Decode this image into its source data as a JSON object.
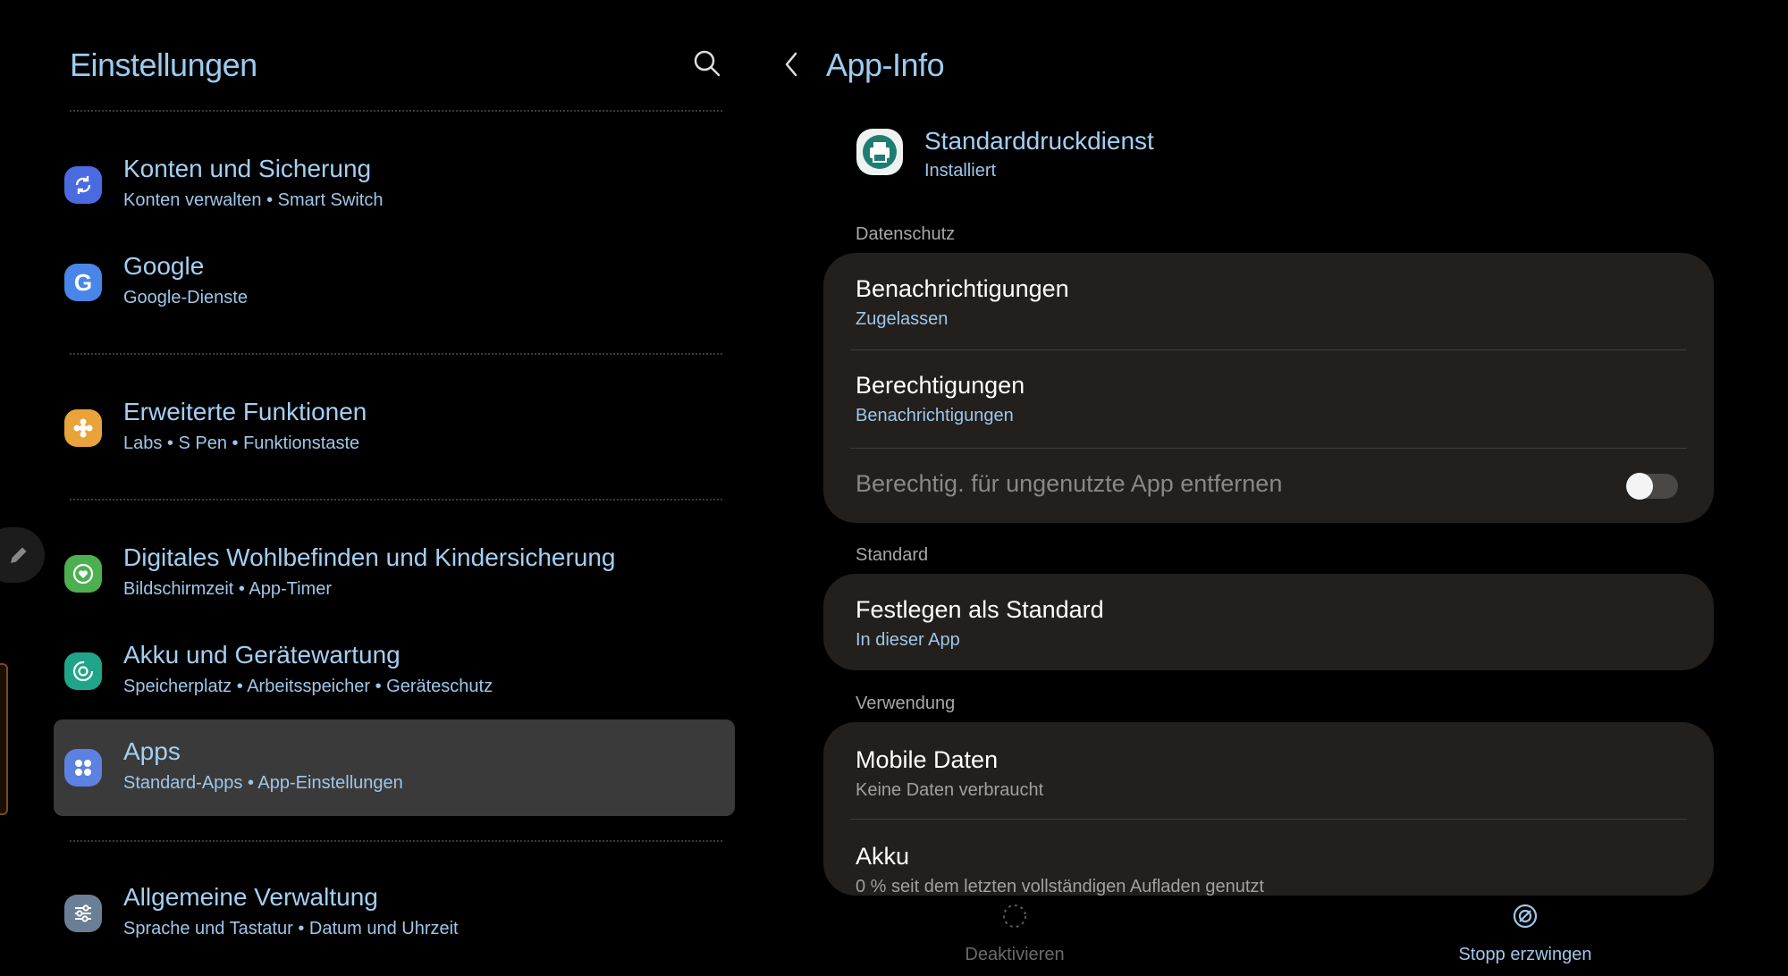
{
  "left": {
    "title": "Einstellungen",
    "items": [
      {
        "title": "Konten und Sicherung",
        "sub": "Konten verwalten  •  Smart Switch",
        "icon": "sync-icon",
        "color": "#4a6be0"
      },
      {
        "title": "Google",
        "sub": "Google-Dienste",
        "icon": "google-icon",
        "color": "#4a86e8"
      },
      {
        "title": "Erweiterte Funktionen",
        "sub": "Labs  •  S Pen  •  Funktionstaste",
        "icon": "puzzle-icon",
        "color": "#e8a33a"
      },
      {
        "title": "Digitales Wohlbefinden und Kindersicherung",
        "sub": "Bildschirmzeit  •  App-Timer",
        "icon": "heart-icon",
        "color": "#4caf50"
      },
      {
        "title": "Akku und Gerätewartung",
        "sub": "Speicherplatz  •  Arbeitsspeicher  •  Geräteschutz",
        "icon": "battery-care-icon",
        "color": "#20a58a"
      },
      {
        "title": "Apps",
        "sub": "Standard-Apps  •  App-Einstellungen",
        "icon": "apps-icon",
        "color": "#5b82e0"
      },
      {
        "title": "Allgemeine Verwaltung",
        "sub": "Sprache und Tastatur  •  Datum und Uhrzeit",
        "icon": "sliders-icon",
        "color": "#6a7f95"
      }
    ]
  },
  "right": {
    "title": "App-Info",
    "app_name": "Standarddruckdienst",
    "app_status": "Installiert",
    "sections": {
      "privacy": "Datenschutz",
      "default": "Standard",
      "usage": "Verwendung"
    },
    "notifications": {
      "title": "Benachrichtigungen",
      "sub": "Zugelassen"
    },
    "permissions": {
      "title": "Berechtigungen",
      "sub": "Benachrichtigungen"
    },
    "unused": {
      "title": "Berechtig. für ungenutzte App entfernen",
      "toggle": "off"
    },
    "set_default": {
      "title": "Festlegen als Standard",
      "sub": "In dieser App"
    },
    "mobile_data": {
      "title": "Mobile Daten",
      "sub": "Keine Daten verbraucht"
    },
    "battery": {
      "title": "Akku",
      "sub": "0 % seit dem letzten vollständigen Aufladen genutzt"
    },
    "bottom": {
      "deactivate": "Deaktivieren",
      "force_stop": "Stopp erzwingen"
    }
  },
  "colors": {
    "accent": "#9ccbf0",
    "card": "#221f1c",
    "selected": "#3a3a3a"
  }
}
